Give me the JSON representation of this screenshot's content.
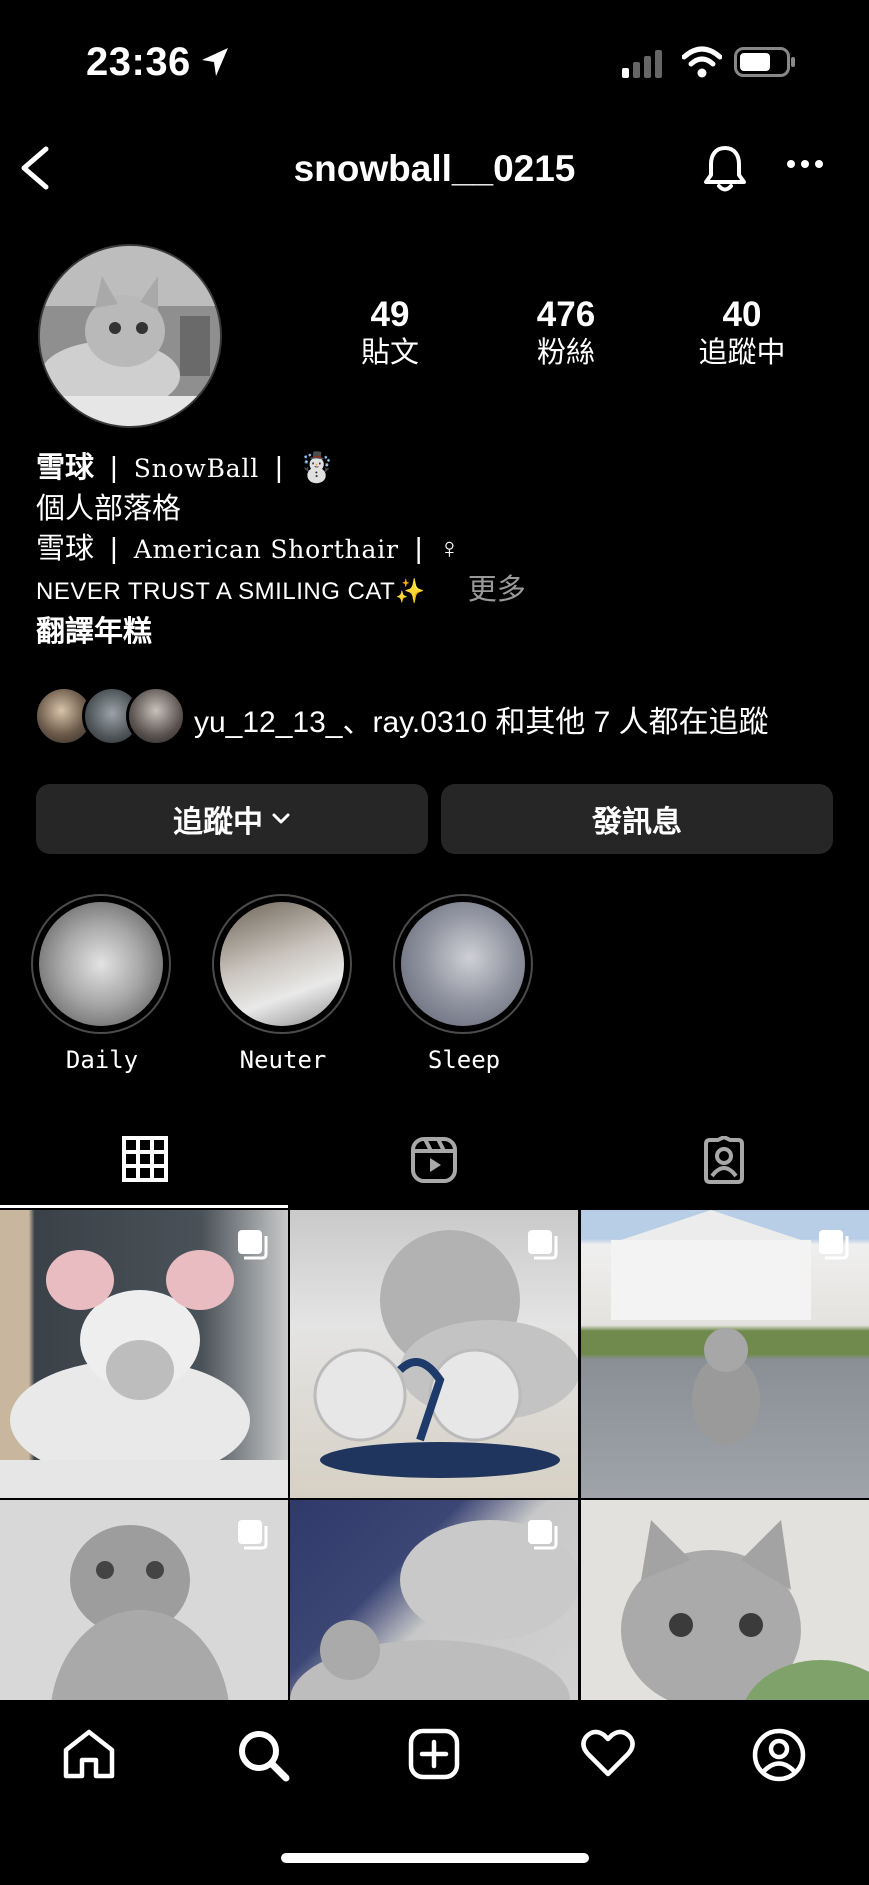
{
  "status_bar": {
    "time": "23:36"
  },
  "header": {
    "username": "snowball__0215"
  },
  "profile": {
    "stats": [
      {
        "value": "49",
        "label": "貼文"
      },
      {
        "value": "476",
        "label": "粉絲"
      },
      {
        "value": "40",
        "label": "追蹤中"
      }
    ],
    "bio": {
      "name_cn": "雪球",
      "name_sep": "|",
      "name_en": "SnowBall",
      "name_emoji": "☃️",
      "category": "個人部落格",
      "line3_cn": "雪球",
      "line3_breed": "American Shorthair",
      "line3_gender": "♀",
      "line4": "NEVER TRUST A SMILING CAT✨",
      "more": "更多",
      "translate": "翻譯年糕"
    },
    "followed_by": "yu_12_13_、ray.0310 和其他 7 人都在追蹤"
  },
  "buttons": {
    "following": "追蹤中",
    "message": "發訊息"
  },
  "highlights": [
    "Daily",
    "Neuter",
    "Sleep"
  ],
  "tabs": [
    "grid-icon",
    "reels-icon",
    "tagged-icon"
  ],
  "nav": [
    "home-icon",
    "search-icon",
    "new-post-icon",
    "activity-icon",
    "profile-icon"
  ]
}
